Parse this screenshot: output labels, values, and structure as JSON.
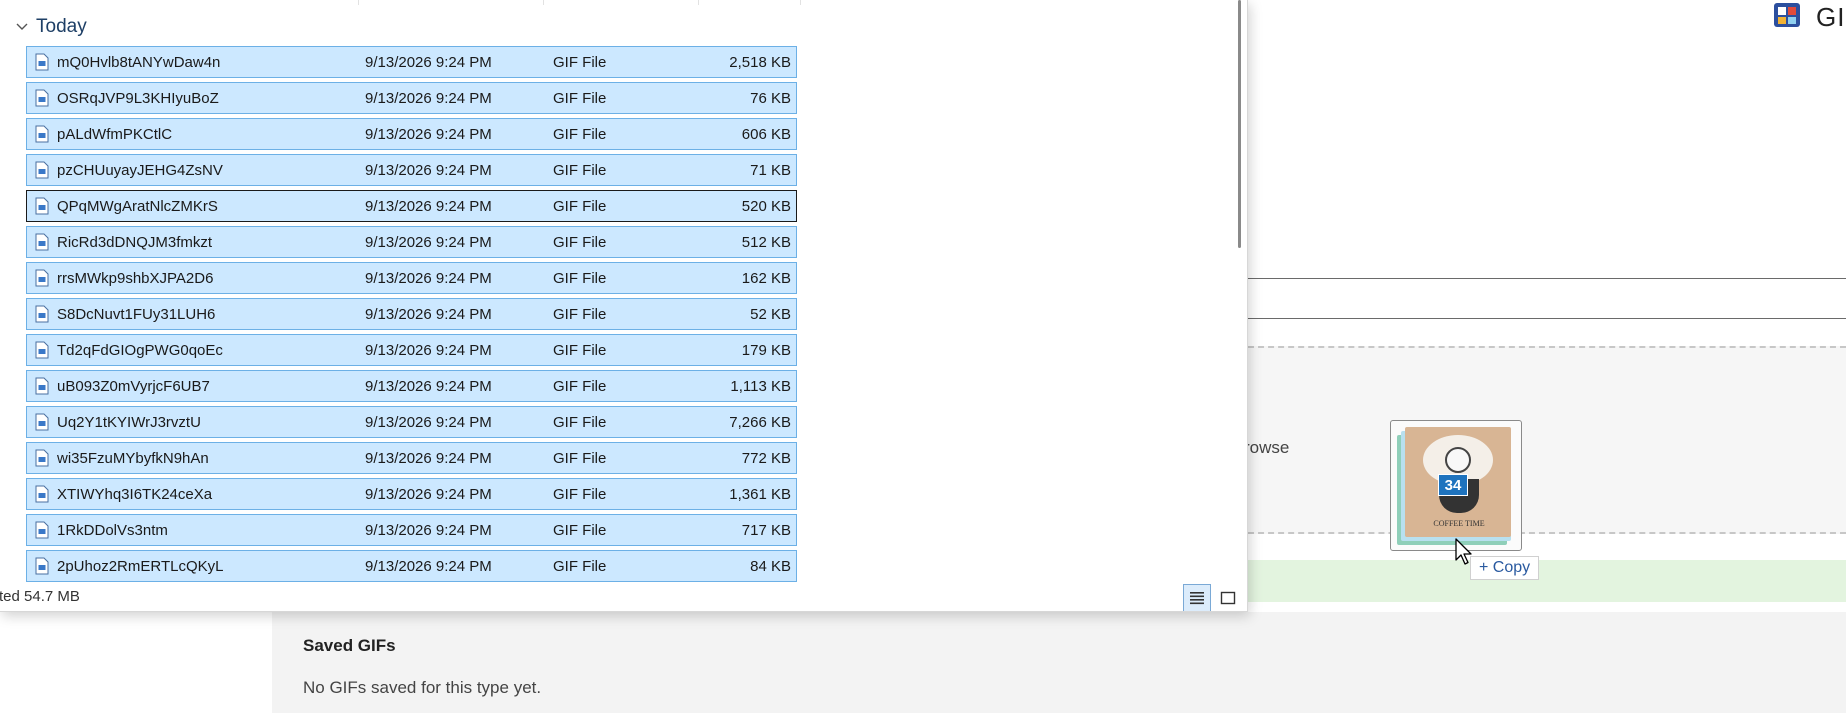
{
  "explorer": {
    "group_label": "Today",
    "files": [
      {
        "name": "mQ0Hvlb8tANYwDaw4n",
        "date": "9/13/2026 9:24 PM",
        "type": "GIF File",
        "size": "2,518 KB"
      },
      {
        "name": "OSRqJVP9L3KHIyuBoZ",
        "date": "9/13/2026 9:24 PM",
        "type": "GIF File",
        "size": "76 KB"
      },
      {
        "name": "pALdWfmPKCtlC",
        "date": "9/13/2026 9:24 PM",
        "type": "GIF File",
        "size": "606 KB"
      },
      {
        "name": "pzCHUuyayJEHG4ZsNV",
        "date": "9/13/2026 9:24 PM",
        "type": "GIF File",
        "size": "71 KB"
      },
      {
        "name": "QPqMWgAratNlcZMKrS",
        "date": "9/13/2026 9:24 PM",
        "type": "GIF File",
        "size": "520 KB"
      },
      {
        "name": "RicRd3dDNQJM3fmkzt",
        "date": "9/13/2026 9:24 PM",
        "type": "GIF File",
        "size": "512 KB"
      },
      {
        "name": "rrsMWkp9shbXJPA2D6",
        "date": "9/13/2026 9:24 PM",
        "type": "GIF File",
        "size": "162 KB"
      },
      {
        "name": "S8DcNuvt1FUy31LUH6",
        "date": "9/13/2026 9:24 PM",
        "type": "GIF File",
        "size": "52 KB"
      },
      {
        "name": "Td2qFdGIOgPWG0qoEc",
        "date": "9/13/2026 9:24 PM",
        "type": "GIF File",
        "size": "179 KB"
      },
      {
        "name": "uB093Z0mVyrjcF6UB7",
        "date": "9/13/2026 9:24 PM",
        "type": "GIF File",
        "size": "1,113 KB"
      },
      {
        "name": "Uq2Y1tKYIWrJ3rvztU",
        "date": "9/13/2026 9:24 PM",
        "type": "GIF File",
        "size": "7,266 KB"
      },
      {
        "name": "wi35FzuMYbyfkN9hAn",
        "date": "9/13/2026 9:24 PM",
        "type": "GIF File",
        "size": "772 KB"
      },
      {
        "name": "XTIWYhq3I6TK24ceXa",
        "date": "9/13/2026 9:24 PM",
        "type": "GIF File",
        "size": "1,361 KB"
      },
      {
        "name": "1RkDDolVs3ntm",
        "date": "9/13/2026 9:24 PM",
        "type": "GIF File",
        "size": "717 KB"
      },
      {
        "name": "2pUhoz2RmERTLcQKyL",
        "date": "9/13/2026 9:24 PM",
        "type": "GIF File",
        "size": "84 KB"
      }
    ],
    "focused_index": 4,
    "status_text": "ted  54.7 MB"
  },
  "app": {
    "header_text": "GI",
    "drop_zone_text": "rowse",
    "saved_title": "Saved GIFs",
    "saved_empty": "No GIFs saved for this type yet."
  },
  "drag": {
    "badge_count": "34",
    "tooltip": "+ Copy",
    "thumb_text": "COFFEE TIME"
  },
  "colors": {
    "selection_bg": "#cce8ff",
    "selection_border": "#6cb0e6",
    "accent_blue": "#1e73be",
    "drop_green": "#e3f4df"
  }
}
